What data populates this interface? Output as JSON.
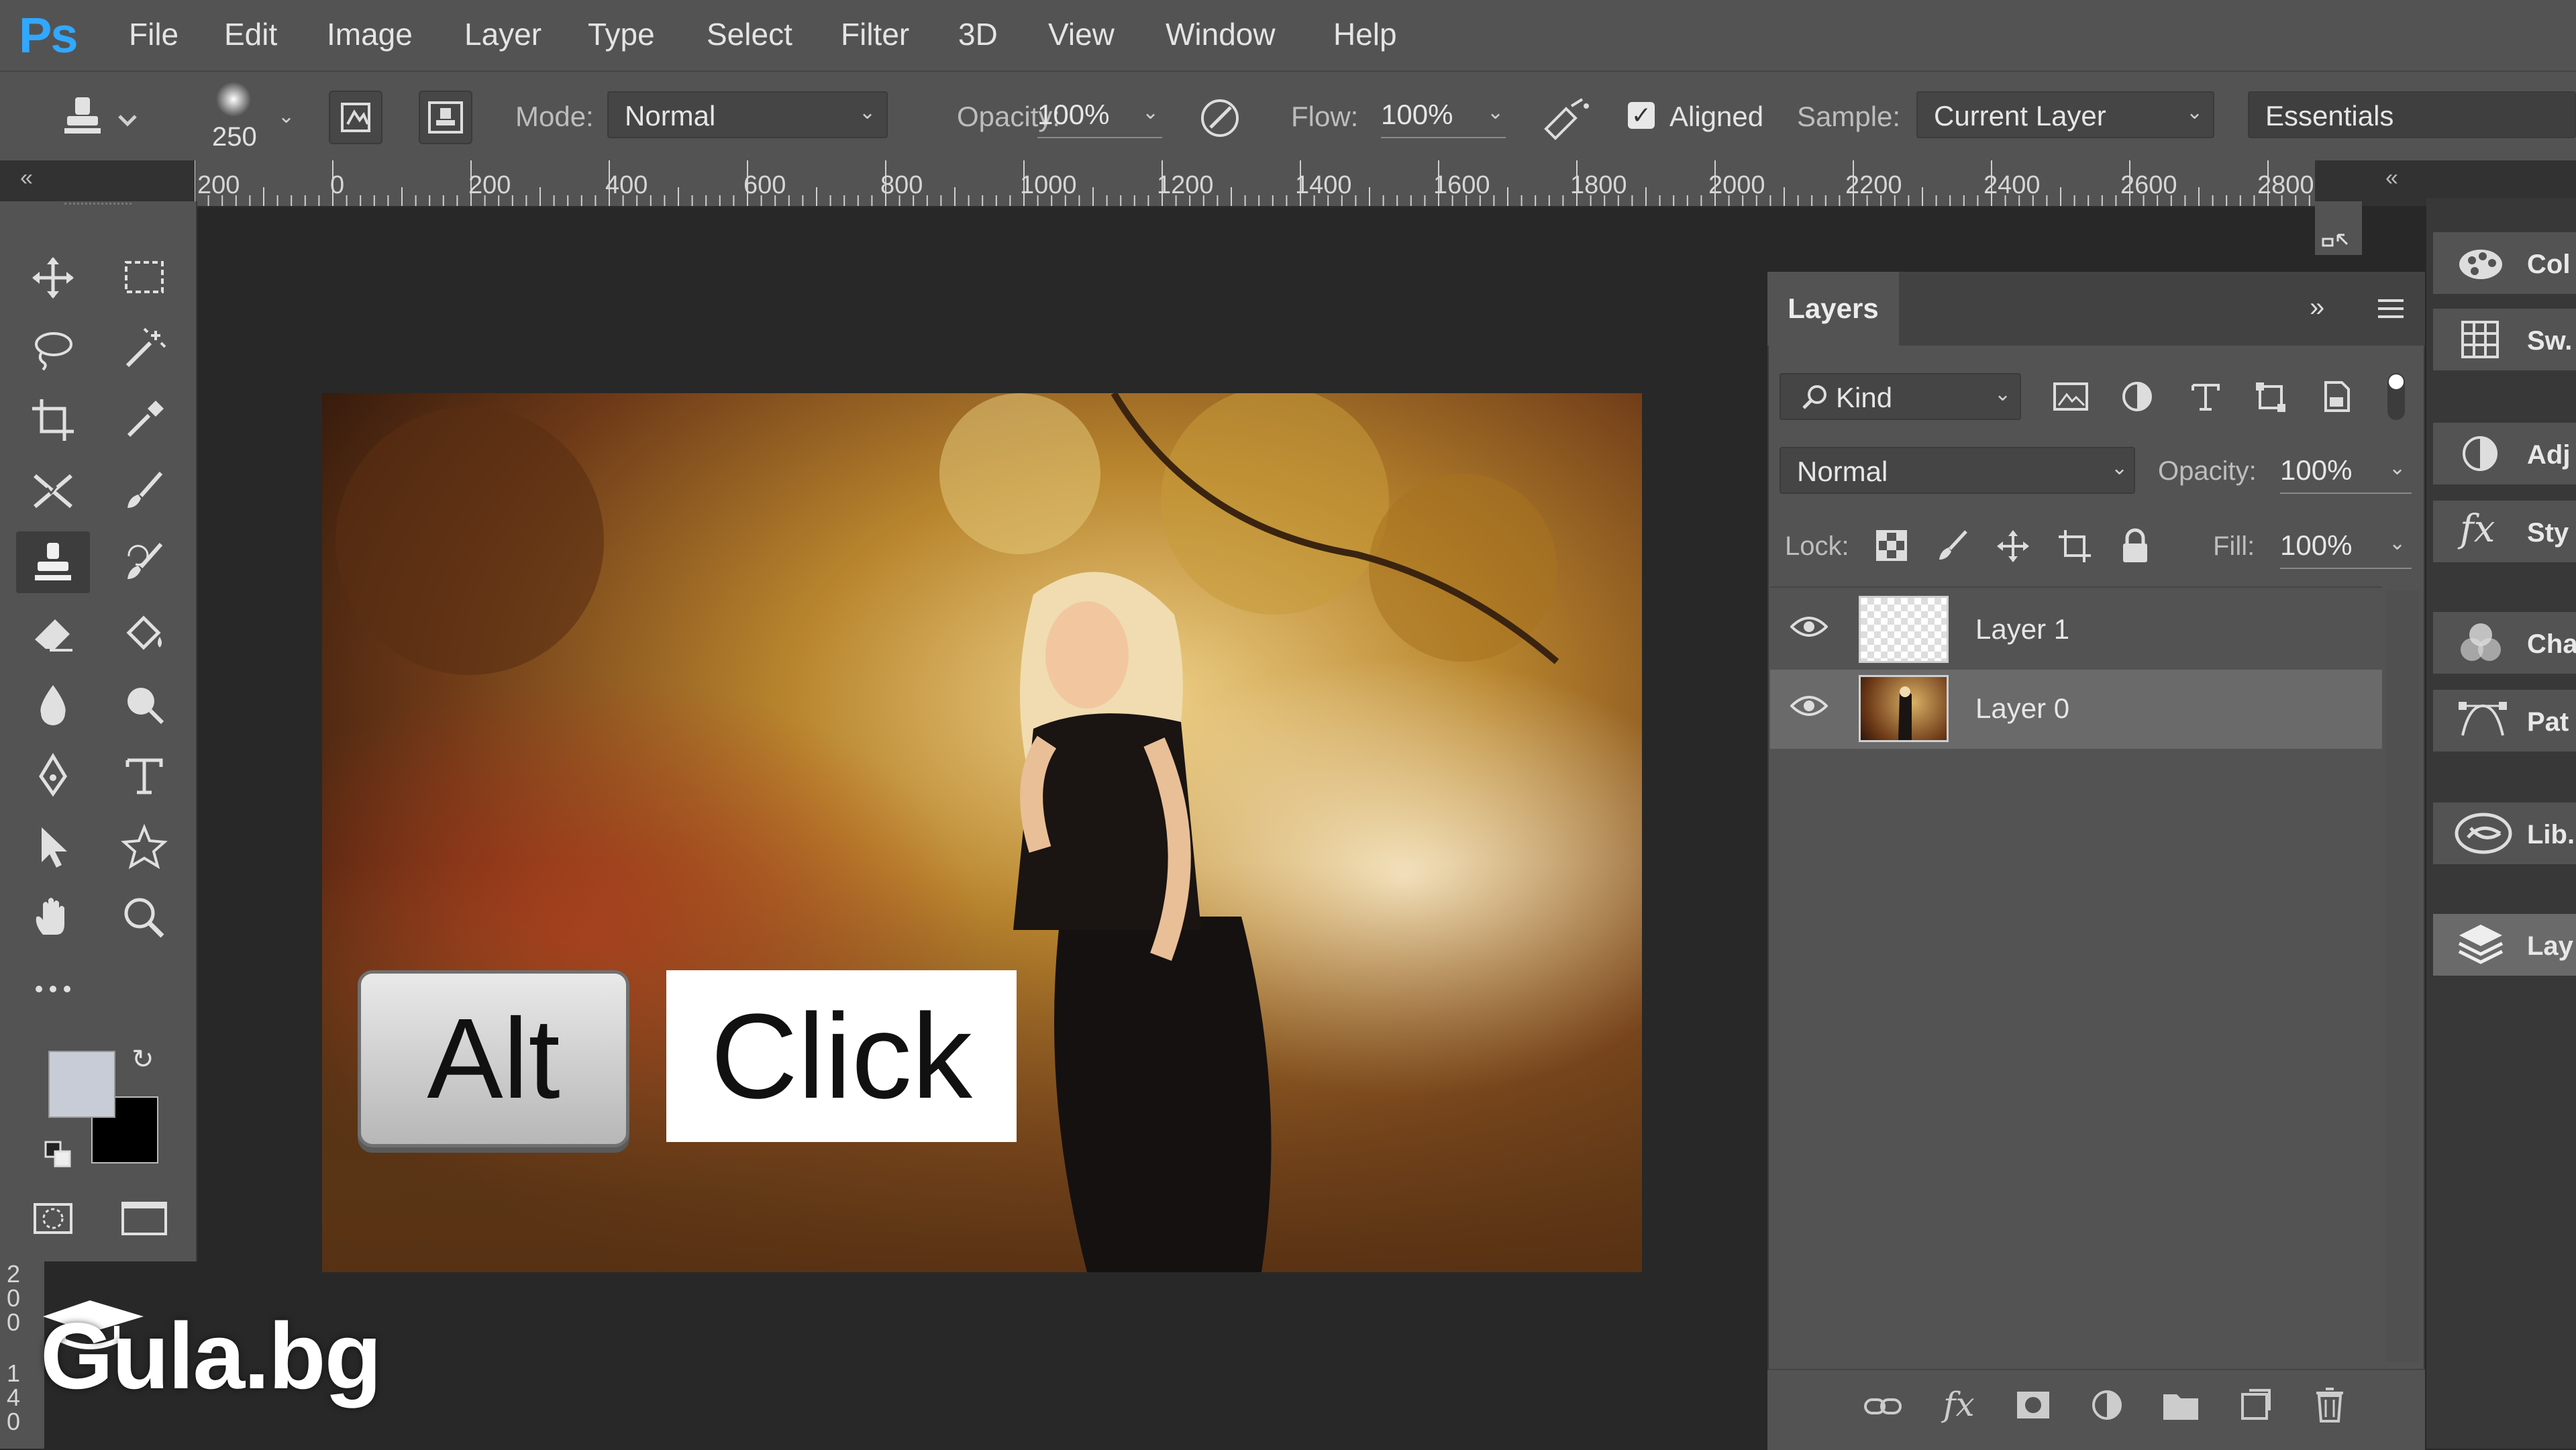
{
  "app": {
    "logo": "Ps"
  },
  "menu": [
    "File",
    "Edit",
    "Image",
    "Layer",
    "Type",
    "Select",
    "Filter",
    "3D",
    "View",
    "Window",
    "Help"
  ],
  "options": {
    "brush_size": "250",
    "mode_label": "Mode:",
    "mode_value": "Normal",
    "opacity_label": "Opacity:",
    "opacity_value": "100%",
    "flow_label": "Flow:",
    "flow_value": "100%",
    "aligned_label": "Aligned",
    "aligned_checked": true,
    "sample_label": "Sample:",
    "sample_value": "Current Layer",
    "workspace": "Essentials"
  },
  "ruler": {
    "labels": [
      "200",
      "0",
      "200",
      "400",
      "600",
      "800",
      "1000",
      "1200",
      "1400",
      "1600",
      "1800",
      "2000",
      "2200",
      "2400",
      "2600",
      "2800"
    ],
    "vertical_labels": [
      "2",
      "0",
      "0",
      "1",
      "4",
      "0"
    ]
  },
  "colors": {
    "foreground": "#c8ccd6",
    "background": "#000000",
    "accent": "#31a8ff"
  },
  "overlay": {
    "key_label": "Alt",
    "action_label": "Click"
  },
  "layers_panel": {
    "title": "Layers",
    "filter_kind": "Kind",
    "blend_mode": "Normal",
    "opacity_label": "Opacity:",
    "opacity_value": "100%",
    "lock_label": "Lock:",
    "fill_label": "Fill:",
    "fill_value": "100%",
    "layers": [
      {
        "name": "Layer 1",
        "visible": true,
        "selected": false
      },
      {
        "name": "Layer 0",
        "visible": true,
        "selected": true
      }
    ]
  },
  "right_dock": [
    "Col",
    "Sw.",
    "Adj",
    "Sty",
    "Cha",
    "Pat",
    "Lib.",
    "Lay"
  ],
  "watermark": "Gula.bg"
}
